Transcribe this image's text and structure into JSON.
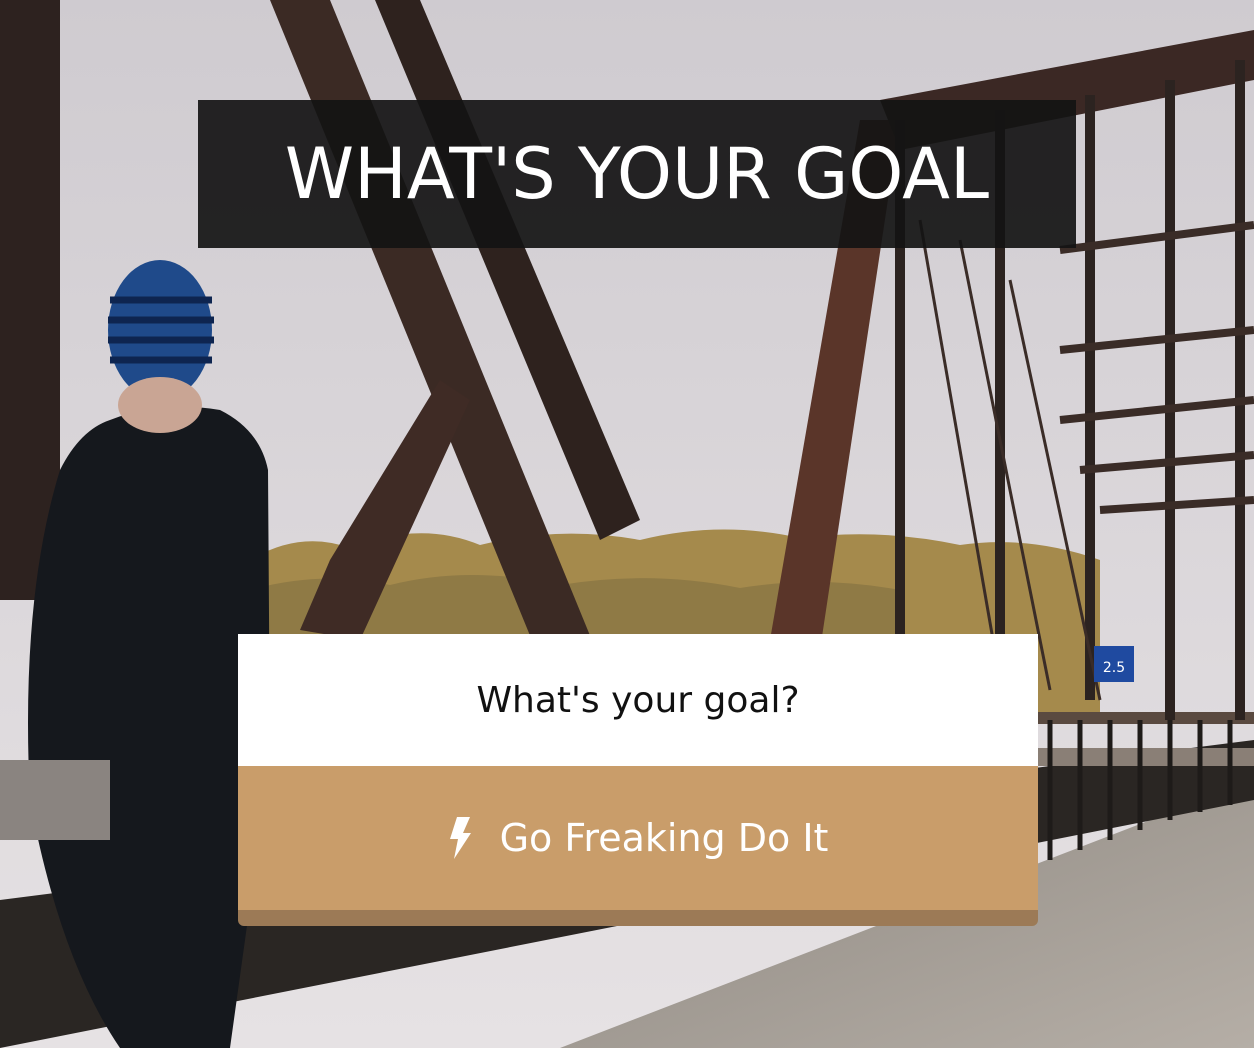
{
  "banner": {
    "title": "WHAT'S YOUR GOAL"
  },
  "form": {
    "goal_placeholder": "What's your goal?",
    "submit_label": "Go Freaking Do It",
    "submit_icon": "lightning-bolt-icon"
  },
  "background": {
    "description_icon": "runner-on-bridge-photo",
    "sign_text": "2.5"
  },
  "colors": {
    "banner_bg": "#141414",
    "button_bg": "#c99d6a",
    "button_shadow": "#9c7a56",
    "input_bg": "#ffffff"
  }
}
